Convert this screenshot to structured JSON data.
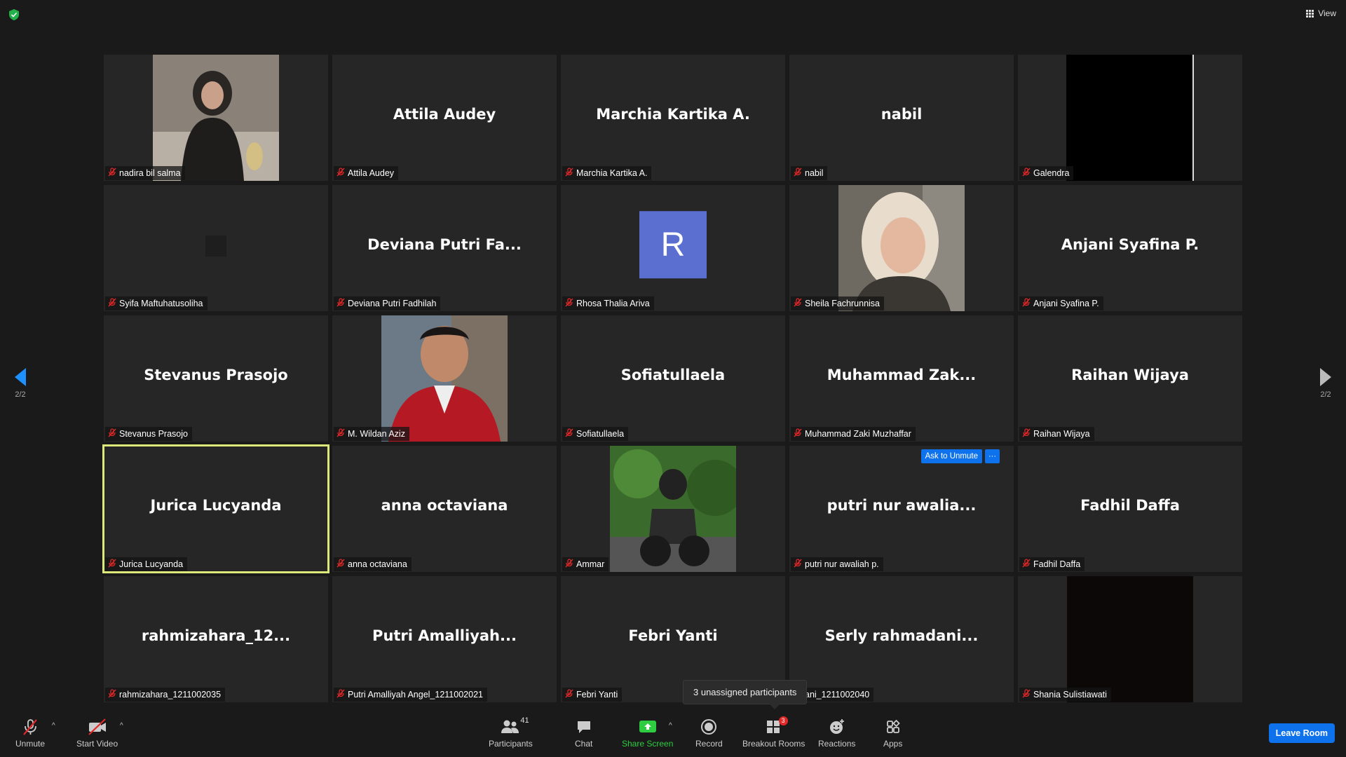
{
  "top": {
    "view_label": "View"
  },
  "pagination": {
    "left": "2/2",
    "right": "2/2"
  },
  "tiles": [
    {
      "display": "",
      "tag": "nadira bil salma",
      "kind": "photo1"
    },
    {
      "display": "Attila Audey",
      "tag": "Attila Audey"
    },
    {
      "display": "Marchia Kartika A.",
      "tag": "Marchia Kartika A."
    },
    {
      "display": "nabil",
      "tag": "nabil"
    },
    {
      "display": "",
      "tag": "Galendra",
      "kind": "black"
    },
    {
      "display": "",
      "tag": "Syifa Maftuhatusoliha",
      "kind": "smallsq"
    },
    {
      "display": "Deviana  Putri  Fa...",
      "tag": "Deviana Putri Fadhilah"
    },
    {
      "display": "",
      "tag": "Rhosa Thalia Ariva",
      "kind": "avatar",
      "avatar_letter": "R"
    },
    {
      "display": "",
      "tag": "Sheila Fachrunnisa",
      "kind": "photo2"
    },
    {
      "display": "Anjani Syafina P.",
      "tag": "Anjani Syafina P."
    },
    {
      "display": "Stevanus Prasojo",
      "tag": "Stevanus Prasojo"
    },
    {
      "display": "",
      "tag": "M. Wildan Aziz",
      "kind": "photo3"
    },
    {
      "display": "Sofiatullaela",
      "tag": "Sofiatullaela"
    },
    {
      "display": "Muhammad  Zak...",
      "tag": "Muhammad Zaki Muzhaffar"
    },
    {
      "display": "Raihan Wijaya",
      "tag": "Raihan Wijaya"
    },
    {
      "display": "Jurica Lucyanda",
      "tag": "Jurica Lucyanda",
      "active": true
    },
    {
      "display": "anna octaviana",
      "tag": "anna octaviana"
    },
    {
      "display": "",
      "tag": "Ammar",
      "kind": "photo4"
    },
    {
      "display": "putri  nur  awalia...",
      "tag": "putri nur awaliah p.",
      "ask": true
    },
    {
      "display": "Fadhil Daffa",
      "tag": "Fadhil Daffa"
    },
    {
      "display": "rahmizahara_12...",
      "tag": "rahmizahara_1211002035"
    },
    {
      "display": "Putri  Amalliyah...",
      "tag": "Putri Amalliyah Angel_1211002021"
    },
    {
      "display": "Febri Yanti",
      "tag": "Febri Yanti"
    },
    {
      "display": "Serly  rahmadani...",
      "tag": "ani_1211002040"
    },
    {
      "display": "",
      "tag": "Shania Sulistiawati",
      "kind": "black2"
    }
  ],
  "ask_to_unmute": {
    "label": "Ask to Unmute",
    "more": "···"
  },
  "popup": {
    "text": "3 unassigned participants"
  },
  "toolbar": {
    "unmute": "Unmute",
    "start_video": "Start Video",
    "participants": "Participants",
    "participants_count": "41",
    "chat": "Chat",
    "share_screen": "Share Screen",
    "record": "Record",
    "breakout_rooms": "Breakout Rooms",
    "breakout_badge": "3",
    "reactions": "Reactions",
    "apps": "Apps",
    "leave_room": "Leave Room"
  },
  "colors": {
    "accent": "#0e72ed",
    "share_green": "#2ecc40",
    "active_outline": "#dde87a",
    "mute_red": "#e02828"
  }
}
